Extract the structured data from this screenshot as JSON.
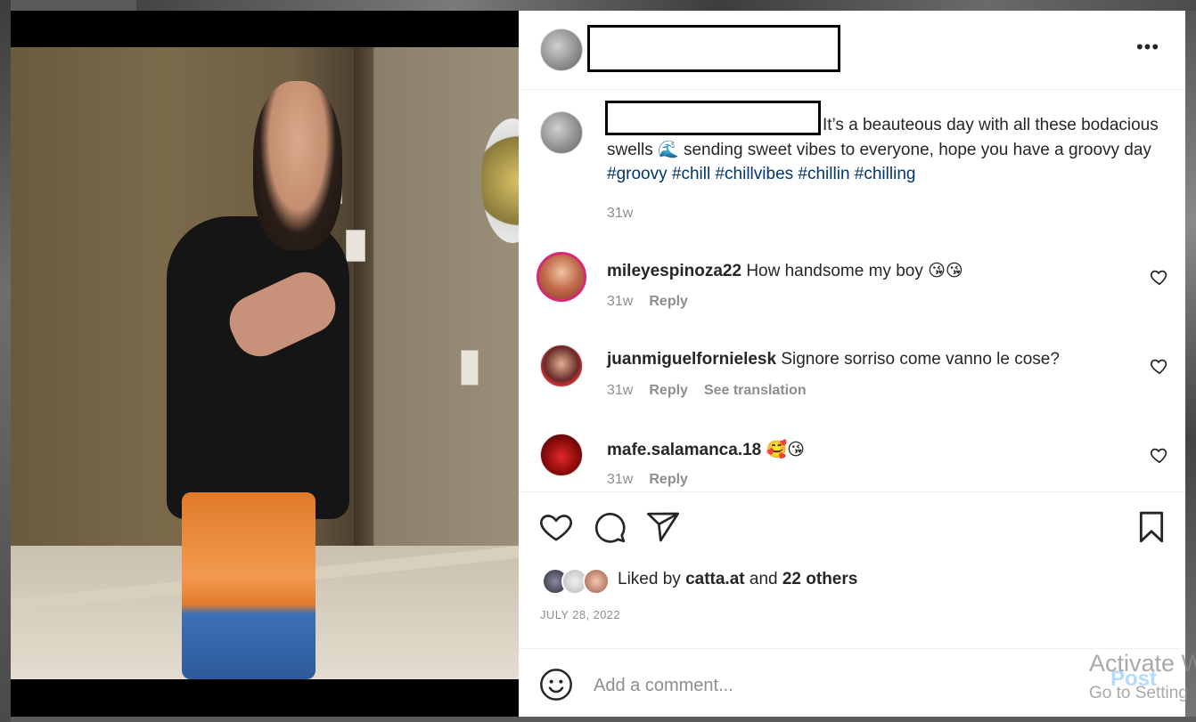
{
  "post": {
    "caption": "It’s a beauteous day with all these bodacious swells",
    "caption_emoji": "🌊",
    "caption_cont": "sending sweet vibes to everyone, hope you have a groovy day",
    "hashtags": [
      "#groovy",
      "#chill",
      "#chillvibes",
      "#chillin",
      "#chilling"
    ],
    "caption_time": "31w",
    "more_label": "•••"
  },
  "comments": [
    {
      "user": "mileyespinoza22",
      "text": "How handsome my boy 😘😘",
      "time": "31w",
      "reply": "Reply",
      "translation": ""
    },
    {
      "user": "juanmiguelfornielesk",
      "text": "Signore sorriso come vanno le cose?",
      "time": "31w",
      "reply": "Reply",
      "translation": "See translation"
    },
    {
      "user": "mafe.salamanca.18",
      "text": "🥰😘",
      "time": "31w",
      "reply": "Reply",
      "translation": ""
    }
  ],
  "likes": {
    "prefix": "Liked by",
    "user": "catta.at",
    "and": "and",
    "others": "22 others"
  },
  "date": "JULY 28, 2022",
  "add_comment": {
    "placeholder": "Add a comment...",
    "post_label": "Post"
  },
  "watermark": {
    "line1": "Activate W",
    "line2": "Go to Setting"
  },
  "icons": [
    "heart-icon",
    "comment-icon",
    "share-icon",
    "bookmark-icon",
    "smiley-icon",
    "more-icon"
  ]
}
